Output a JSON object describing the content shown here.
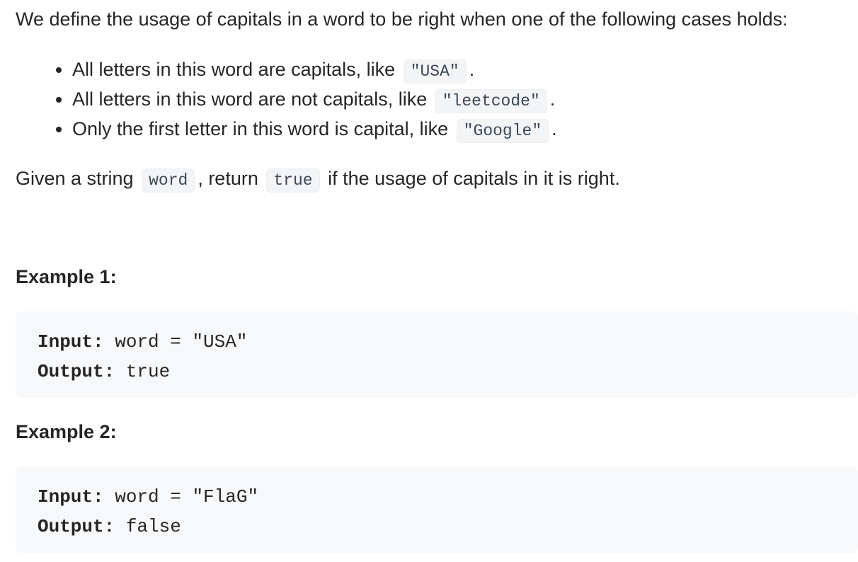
{
  "intro": "We define the usage of capitals in a word to be right when one of the following cases holds:",
  "rules": [
    {
      "text": "All letters in this word are capitals, like",
      "code": "\"USA\"",
      "tail": "."
    },
    {
      "text": "All letters in this word are not capitals, like",
      "code": "\"leetcode\"",
      "tail": "."
    },
    {
      "text": "Only the first letter in this word is capital, like",
      "code": "\"Google\"",
      "tail": "."
    }
  ],
  "given": {
    "part1": "Given a string",
    "code1": "word",
    "part2": ", return",
    "code2": "true",
    "part3": "if the usage of capitals in it is right."
  },
  "examples": [
    {
      "title": "Example 1:",
      "input_label": "Input:",
      "input_value": "word = \"USA\"",
      "output_label": "Output:",
      "output_value": "true"
    },
    {
      "title": "Example 2:",
      "input_label": "Input:",
      "input_value": "word = \"FlaG\"",
      "output_label": "Output:",
      "output_value": "false"
    }
  ]
}
